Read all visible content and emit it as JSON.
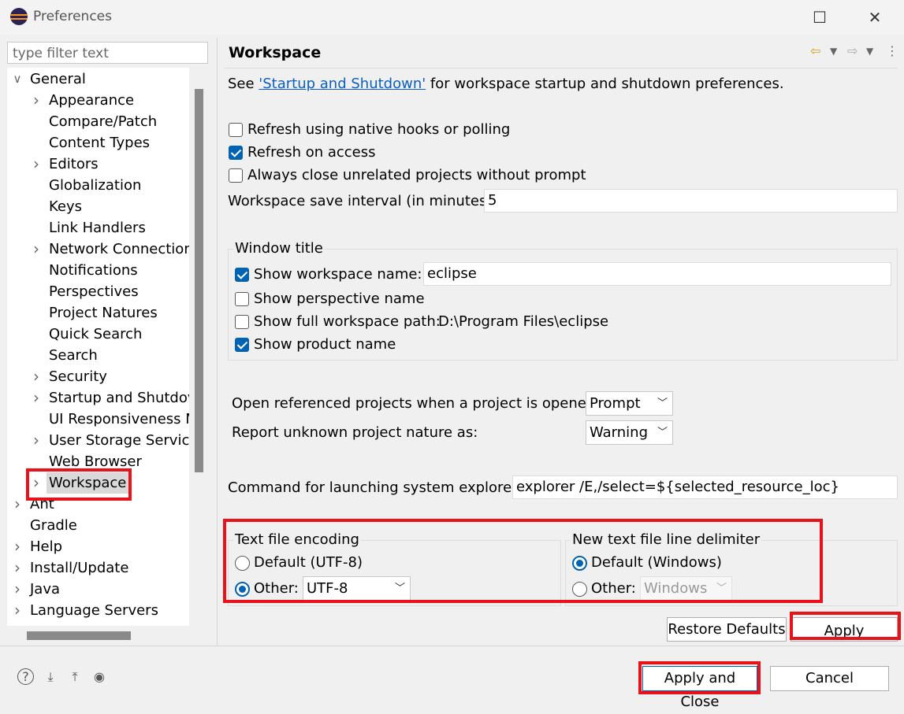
{
  "window": {
    "title": "Preferences"
  },
  "filter": {
    "placeholder": "type filter text"
  },
  "tree": [
    {
      "label": "General",
      "depth": 0,
      "twisty": "open"
    },
    {
      "label": "Appearance",
      "depth": 1,
      "twisty": "closed"
    },
    {
      "label": "Compare/Patch",
      "depth": 1,
      "twisty": ""
    },
    {
      "label": "Content Types",
      "depth": 1,
      "twisty": ""
    },
    {
      "label": "Editors",
      "depth": 1,
      "twisty": "closed"
    },
    {
      "label": "Globalization",
      "depth": 1,
      "twisty": ""
    },
    {
      "label": "Keys",
      "depth": 1,
      "twisty": ""
    },
    {
      "label": "Link Handlers",
      "depth": 1,
      "twisty": ""
    },
    {
      "label": "Network Connection",
      "depth": 1,
      "twisty": "closed"
    },
    {
      "label": "Notifications",
      "depth": 1,
      "twisty": ""
    },
    {
      "label": "Perspectives",
      "depth": 1,
      "twisty": ""
    },
    {
      "label": "Project Natures",
      "depth": 1,
      "twisty": ""
    },
    {
      "label": "Quick Search",
      "depth": 1,
      "twisty": ""
    },
    {
      "label": "Search",
      "depth": 1,
      "twisty": ""
    },
    {
      "label": "Security",
      "depth": 1,
      "twisty": "closed"
    },
    {
      "label": "Startup and Shutdov",
      "depth": 1,
      "twisty": "closed"
    },
    {
      "label": "UI Responsiveness M",
      "depth": 1,
      "twisty": ""
    },
    {
      "label": "User Storage Service",
      "depth": 1,
      "twisty": "closed"
    },
    {
      "label": "Web Browser",
      "depth": 1,
      "twisty": ""
    },
    {
      "label": "Workspace",
      "depth": 1,
      "twisty": "closed",
      "selected": true
    },
    {
      "label": "Ant",
      "depth": 0,
      "twisty": "closed"
    },
    {
      "label": "Gradle",
      "depth": 0,
      "twisty": ""
    },
    {
      "label": "Help",
      "depth": 0,
      "twisty": "closed"
    },
    {
      "label": "Install/Update",
      "depth": 0,
      "twisty": "closed"
    },
    {
      "label": "Java",
      "depth": 0,
      "twisty": "closed"
    },
    {
      "label": "Language Servers",
      "depth": 0,
      "twisty": "closed"
    }
  ],
  "page": {
    "title": "Workspace",
    "intro_prefix": "See ",
    "intro_link": "'Startup and Shutdown'",
    "intro_suffix": " for workspace startup and shutdown preferences.",
    "refresh_native": {
      "label": "Refresh using native hooks or polling",
      "checked": false
    },
    "refresh_access": {
      "label": "Refresh on access",
      "checked": true
    },
    "always_close": {
      "label": "Always close unrelated projects without prompt",
      "checked": false
    },
    "save_interval": {
      "label": "Workspace save interval (in minutes):",
      "value": "5"
    },
    "window_title": {
      "group_label": "Window title",
      "show_ws_name": {
        "label": "Show workspace name:",
        "checked": true,
        "value": "eclipse"
      },
      "show_persp": {
        "label": "Show perspective name",
        "checked": false
      },
      "show_path": {
        "label": "Show full workspace path:",
        "checked": false,
        "value": "D:\\Program Files\\eclipse"
      },
      "show_product": {
        "label": "Show product name",
        "checked": true
      }
    },
    "open_ref": {
      "label": "Open referenced projects when a project is opened:",
      "value": "Prompt"
    },
    "report_nature": {
      "label": "Report unknown project nature as:",
      "value": "Warning"
    },
    "explorer_cmd": {
      "label": "Command for launching system explorer:",
      "value": "explorer /E,/select=${selected_resource_loc}"
    },
    "encoding": {
      "group_label": "Text file encoding",
      "default_label": "Default (UTF-8)",
      "other_label": "Other:",
      "other_value": "UTF-8",
      "selected": "other"
    },
    "delimiter": {
      "group_label": "New text file line delimiter",
      "default_label": "Default (Windows)",
      "other_label": "Other:",
      "other_value": "Windows",
      "selected": "default"
    },
    "restore_defaults": "Restore Defaults",
    "apply": "Apply"
  },
  "footer": {
    "apply_close": "Apply and Close",
    "cancel": "Cancel"
  },
  "colors": {
    "highlight": "#e8121b",
    "accent": "#0063b1",
    "link": "#0b5fbf"
  }
}
